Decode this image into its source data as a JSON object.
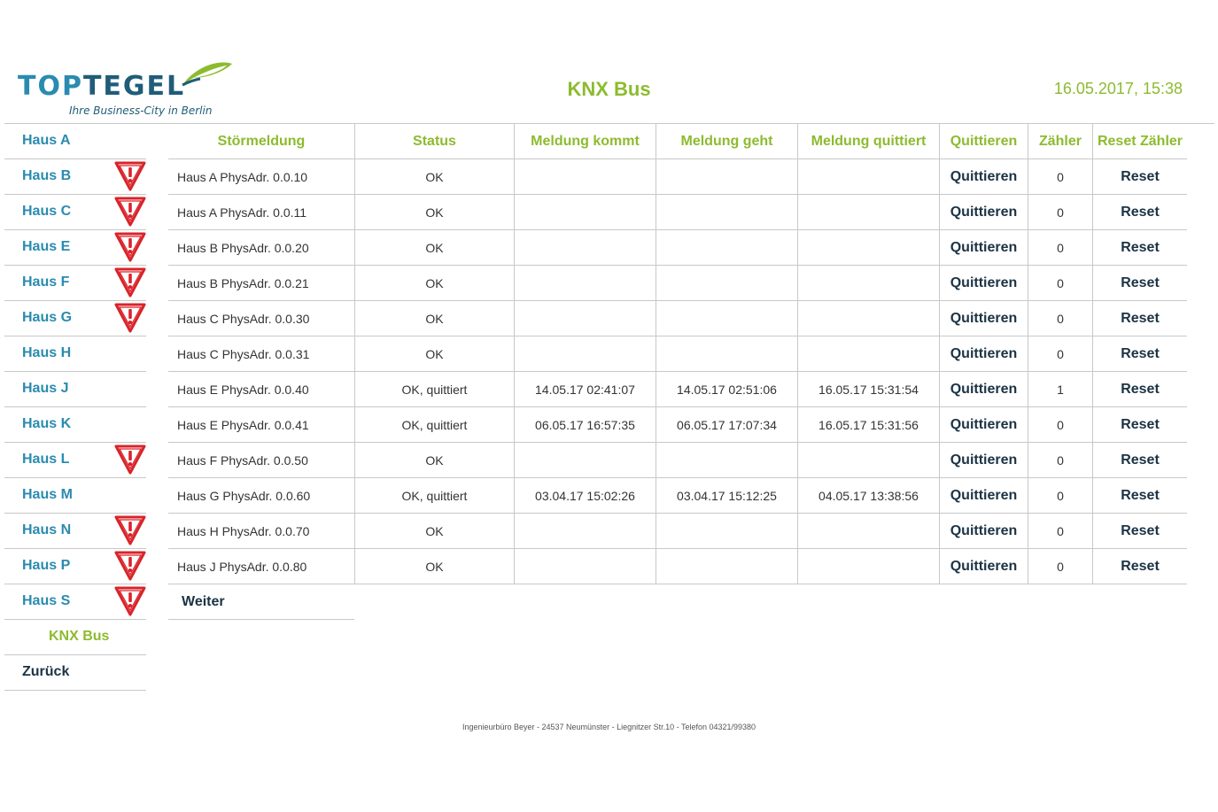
{
  "header": {
    "logo_top": "TOP",
    "logo_tegel": "TEGEL",
    "logo_tagline": "Ihre Business-City in Berlin",
    "title": "KNX Bus",
    "datetime": "16.05.2017, 15:38"
  },
  "colors": {
    "brand_green": "#8dbb2f",
    "brand_blue": "#2a8bb0",
    "warning_red": "#d9232a"
  },
  "sidebar": {
    "items": [
      {
        "label": "Haus A",
        "warning": false
      },
      {
        "label": "Haus B",
        "warning": true
      },
      {
        "label": "Haus C",
        "warning": true
      },
      {
        "label": "Haus E",
        "warning": true
      },
      {
        "label": "Haus F",
        "warning": true
      },
      {
        "label": "Haus G",
        "warning": true
      },
      {
        "label": "Haus H",
        "warning": false
      },
      {
        "label": "Haus J",
        "warning": false
      },
      {
        "label": "Haus K",
        "warning": false
      },
      {
        "label": "Haus L",
        "warning": true
      },
      {
        "label": "Haus M",
        "warning": false
      },
      {
        "label": "Haus N",
        "warning": true
      },
      {
        "label": "Haus P",
        "warning": true
      },
      {
        "label": "Haus S",
        "warning": true
      }
    ],
    "active": "KNX Bus",
    "back": "Zurück"
  },
  "table": {
    "headers": [
      "Störmeldung",
      "Status",
      "Meldung kommt",
      "Meldung geht",
      "Meldung quittiert",
      "Quittieren",
      "Zähler",
      "Reset Zähler"
    ],
    "rows": [
      {
        "meldung": "Haus A PhysAdr. 0.0.10",
        "status": "OK",
        "kommt": "",
        "geht": "",
        "quittiert": "",
        "quit_btn": "Quittieren",
        "zaehler": "0",
        "reset_btn": "Reset"
      },
      {
        "meldung": "Haus A PhysAdr. 0.0.11",
        "status": "OK",
        "kommt": "",
        "geht": "",
        "quittiert": "",
        "quit_btn": "Quittieren",
        "zaehler": "0",
        "reset_btn": "Reset"
      },
      {
        "meldung": "Haus B PhysAdr. 0.0.20",
        "status": "OK",
        "kommt": "",
        "geht": "",
        "quittiert": "",
        "quit_btn": "Quittieren",
        "zaehler": "0",
        "reset_btn": "Reset"
      },
      {
        "meldung": "Haus B PhysAdr. 0.0.21",
        "status": "OK",
        "kommt": "",
        "geht": "",
        "quittiert": "",
        "quit_btn": "Quittieren",
        "zaehler": "0",
        "reset_btn": "Reset"
      },
      {
        "meldung": "Haus C PhysAdr. 0.0.30",
        "status": "OK",
        "kommt": "",
        "geht": "",
        "quittiert": "",
        "quit_btn": "Quittieren",
        "zaehler": "0",
        "reset_btn": "Reset"
      },
      {
        "meldung": "Haus C PhysAdr. 0.0.31",
        "status": "OK",
        "kommt": "",
        "geht": "",
        "quittiert": "",
        "quit_btn": "Quittieren",
        "zaehler": "0",
        "reset_btn": "Reset"
      },
      {
        "meldung": "Haus E PhysAdr. 0.0.40",
        "status": "OK, quittiert",
        "kommt": "14.05.17 02:41:07",
        "geht": "14.05.17 02:51:06",
        "quittiert": "16.05.17 15:31:54",
        "quit_btn": "Quittieren",
        "zaehler": "1",
        "reset_btn": "Reset"
      },
      {
        "meldung": "Haus E PhysAdr. 0.0.41",
        "status": "OK, quittiert",
        "kommt": "06.05.17 16:57:35",
        "geht": "06.05.17 17:07:34",
        "quittiert": "16.05.17 15:31:56",
        "quit_btn": "Quittieren",
        "zaehler": "0",
        "reset_btn": "Reset"
      },
      {
        "meldung": "Haus F PhysAdr. 0.0.50",
        "status": "OK",
        "kommt": "",
        "geht": "",
        "quittiert": "",
        "quit_btn": "Quittieren",
        "zaehler": "0",
        "reset_btn": "Reset"
      },
      {
        "meldung": "Haus G PhysAdr. 0.0.60",
        "status": "OK, quittiert",
        "kommt": "03.04.17 15:02:26",
        "geht": "03.04.17 15:12:25",
        "quittiert": "04.05.17 13:38:56",
        "quit_btn": "Quittieren",
        "zaehler": "0",
        "reset_btn": "Reset"
      },
      {
        "meldung": "Haus H PhysAdr. 0.0.70",
        "status": "OK",
        "kommt": "",
        "geht": "",
        "quittiert": "",
        "quit_btn": "Quittieren",
        "zaehler": "0",
        "reset_btn": "Reset"
      },
      {
        "meldung": "Haus J PhysAdr. 0.0.80",
        "status": "OK",
        "kommt": "",
        "geht": "",
        "quittiert": "",
        "quit_btn": "Quittieren",
        "zaehler": "0",
        "reset_btn": "Reset"
      }
    ],
    "next": "Weiter"
  },
  "footer": "Ingenieurbüro Beyer - 24537 Neumünster - Liegnitzer Str.10 - Telefon 04321/99380"
}
